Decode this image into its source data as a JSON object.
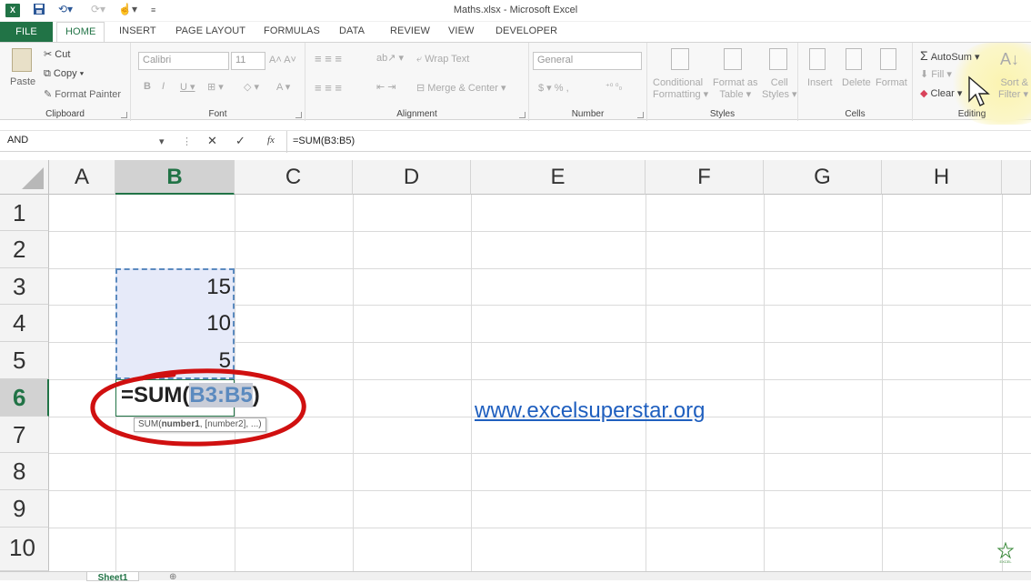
{
  "title": "Maths.xlsx - Microsoft Excel",
  "app_icon": "X",
  "tabs": [
    "FILE",
    "HOME",
    "INSERT",
    "PAGE LAYOUT",
    "FORMULAS",
    "DATA",
    "REVIEW",
    "VIEW",
    "DEVELOPER"
  ],
  "clipboard": {
    "paste": "Paste",
    "cut": "Cut",
    "copy": "Copy",
    "format_painter": "Format Painter",
    "label": "Clipboard"
  },
  "font": {
    "name": "Calibri",
    "size": "11",
    "label": "Font"
  },
  "alignment": {
    "wrap": "Wrap Text",
    "merge": "Merge & Center",
    "label": "Alignment"
  },
  "number": {
    "format": "General",
    "label": "Number"
  },
  "styles": {
    "conditional": "Conditional",
    "formatting": "Formatting",
    "format_as": "Format as",
    "table": "Table",
    "cell": "Cell",
    "styles_word": "Styles",
    "label": "Styles"
  },
  "cells": {
    "insert": "Insert",
    "delete": "Delete",
    "format": "Format",
    "label": "Cells"
  },
  "editing": {
    "autosum": "AutoSum",
    "fill": "Fill",
    "clear": "Clear",
    "sort": "Sort &",
    "filter": "Filter",
    "label": "Editing"
  },
  "formula_bar": {
    "name_box": "AND",
    "cancel": "✕",
    "enter": "✓",
    "fx": "fx",
    "formula": "=SUM(B3:B5)"
  },
  "columns": [
    "A",
    "B",
    "C",
    "D",
    "E",
    "F",
    "G",
    "H"
  ],
  "rows": [
    "1",
    "2",
    "3",
    "4",
    "5",
    "6",
    "7",
    "8",
    "9",
    "10"
  ],
  "cells_data": {
    "b3": "15",
    "b4": "10",
    "b5": "5"
  },
  "edit_cell": {
    "prefix": "=SUM(",
    "ref": "B3:B5",
    "suffix": ")"
  },
  "tooltip": {
    "func": "SUM(",
    "arg1": "number1",
    ",rest": ", [number2], ...)"
  },
  "link": "www.excelsuperstar.org",
  "sheet_tab": "Sheet1",
  "watermark": "EXCEL SUPERSTAR"
}
